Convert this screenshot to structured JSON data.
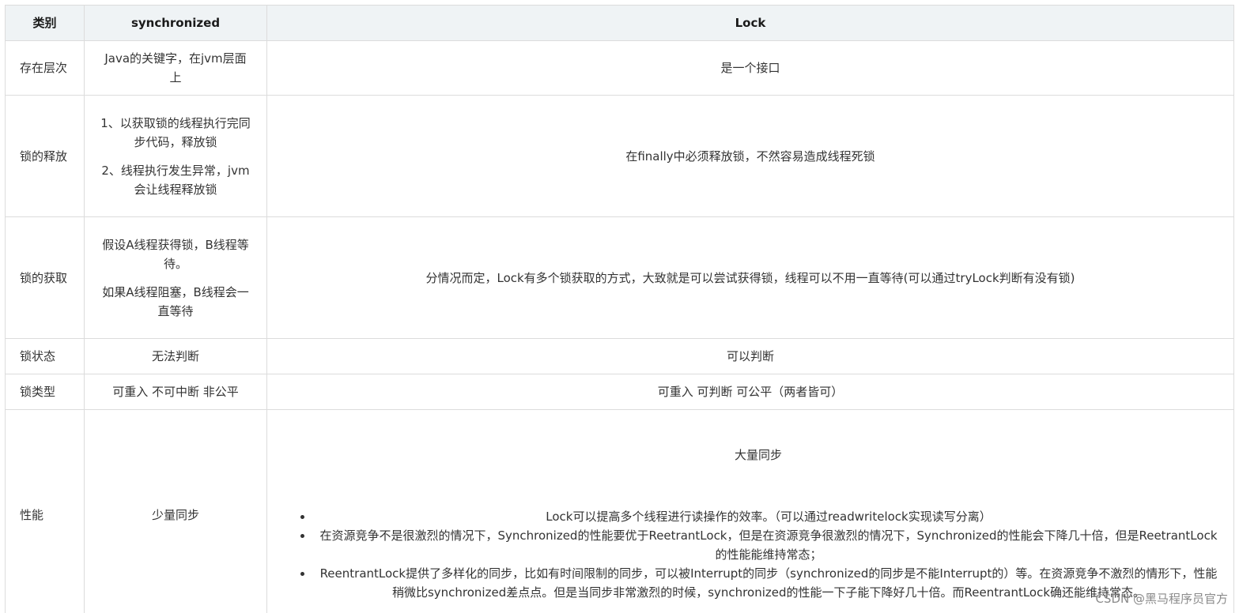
{
  "headers": {
    "category": "类别",
    "sync": "synchronized",
    "lock": "Lock"
  },
  "rows": [
    {
      "category": "存在层次",
      "sync": [
        "Java的关键字，在jvm层面上"
      ],
      "lock": "是一个接口"
    },
    {
      "category": "锁的释放",
      "sync": [
        "1、以获取锁的线程执行完同步代码，释放锁",
        "2、线程执行发生异常，jvm会让线程释放锁"
      ],
      "lock": "在finally中必须释放锁，不然容易造成线程死锁"
    },
    {
      "category": "锁的获取",
      "sync": [
        "假设A线程获得锁，B线程等待。",
        "如果A线程阻塞，B线程会一直等待"
      ],
      "lock": "分情况而定，Lock有多个锁获取的方式，大致就是可以尝试获得锁，线程可以不用一直等待(可以通过tryLock判断有没有锁)"
    },
    {
      "category": "锁状态",
      "sync": [
        "无法判断"
      ],
      "lock": "可以判断"
    },
    {
      "category": "锁类型",
      "sync": [
        "可重入 不可中断 非公平"
      ],
      "lock": "可重入 可判断 可公平（两者皆可）"
    },
    {
      "category": "性能",
      "sync": [
        "少量同步"
      ],
      "lock_title": "大量同步",
      "lock_bullets": [
        "Lock可以提高多个线程进行读操作的效率。（可以通过readwritelock实现读写分离）",
        "在资源竞争不是很激烈的情况下，Synchronized的性能要优于ReetrantLock，但是在资源竞争很激烈的情况下，Synchronized的性能会下降几十倍，但是ReetrantLock的性能能维持常态；",
        "ReentrantLock提供了多样化的同步，比如有时间限制的同步，可以被Interrupt的同步（synchronized的同步是不能Interrupt的）等。在资源竞争不激烈的情形下，性能稍微比synchronized差点点。但是当同步非常激烈的时候，synchronized的性能一下子能下降好几十倍。而ReentrantLock确还能维持常态。"
      ]
    }
  ],
  "watermark": "CSDN @黑马程序员官方"
}
